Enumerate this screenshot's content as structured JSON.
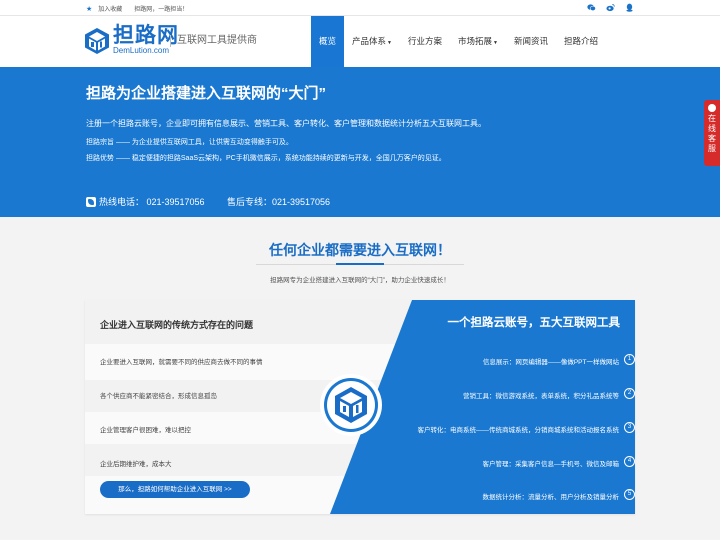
{
  "topbar": {
    "bookmark": "加入收藏",
    "tagline": "担路网，一路担当！"
  },
  "header": {
    "logo_name": "担路网",
    "logo_domain": "DemLution.com",
    "slogan": "互联网工具提供商"
  },
  "nav": [
    {
      "label": "概览",
      "active": true,
      "dropdown": false
    },
    {
      "label": "产品体系",
      "active": false,
      "dropdown": true
    },
    {
      "label": "行业方案",
      "active": false,
      "dropdown": false
    },
    {
      "label": "市场拓展",
      "active": false,
      "dropdown": true
    },
    {
      "label": "新闻资讯",
      "active": false,
      "dropdown": false
    },
    {
      "label": "担路介绍",
      "active": false,
      "dropdown": false
    }
  ],
  "banner": {
    "title": "担路为企业搭建进入互联网的“大门”",
    "p1": "注册一个担路云账号，企业即可拥有信息展示、营销工具、客户转化、客户管理和数据统计分析五大互联网工具。",
    "p2": "担路宗旨 —— 为企业提供互联网工具，让供需互动变得触手可及。",
    "p3": "担路优势 —— 稳定便捷的担路SaaS云架构，PC手机微信展示，系统功能持续的更新与开发，全国几万客户的见证。",
    "hotline": "热线电话： 021-39517056",
    "after_sales": "售后专线：021-39517056"
  },
  "online_service": "在线客服",
  "section": {
    "title": "任何企业都需要进入互联网！",
    "subtitle": "担路网专为企业搭建进入互联网的“大门”，助力企业快速成长！"
  },
  "left_panel": {
    "title": "企业进入互联网的传统方式存在的问题",
    "items": [
      "企业要进入互联网，就需要不同的供应商去做不同的事情",
      "各个供应商不能紧密结合，形成信息孤岛",
      "企业管理客户很困难，难以把控",
      "企业后期维护难，成本大"
    ],
    "button": "那么，担路如何帮助企业进入互联网 >>"
  },
  "right_panel": {
    "title": "一个担路云账号，五大互联网工具",
    "items": [
      {
        "text": "信息展示：网页编辑器——像做PPT一样做网站",
        "num": "1"
      },
      {
        "text": "营销工具：微信游戏系统，表单系统，积分礼品系统等",
        "num": "2"
      },
      {
        "text": "客户转化：电商系统——传统商城系统，分销商城系统和活动报名系统",
        "num": "3"
      },
      {
        "text": "客户管理：采集客户信息—手机号、微信及邮箱",
        "num": "4"
      },
      {
        "text": "数据统计分析：流量分析、用户分析及销量分析",
        "num": "5"
      }
    ]
  },
  "colors": {
    "brand": "#1a78d0",
    "dark_brand": "#1a6dc6",
    "service_red": "#d62b2b"
  }
}
